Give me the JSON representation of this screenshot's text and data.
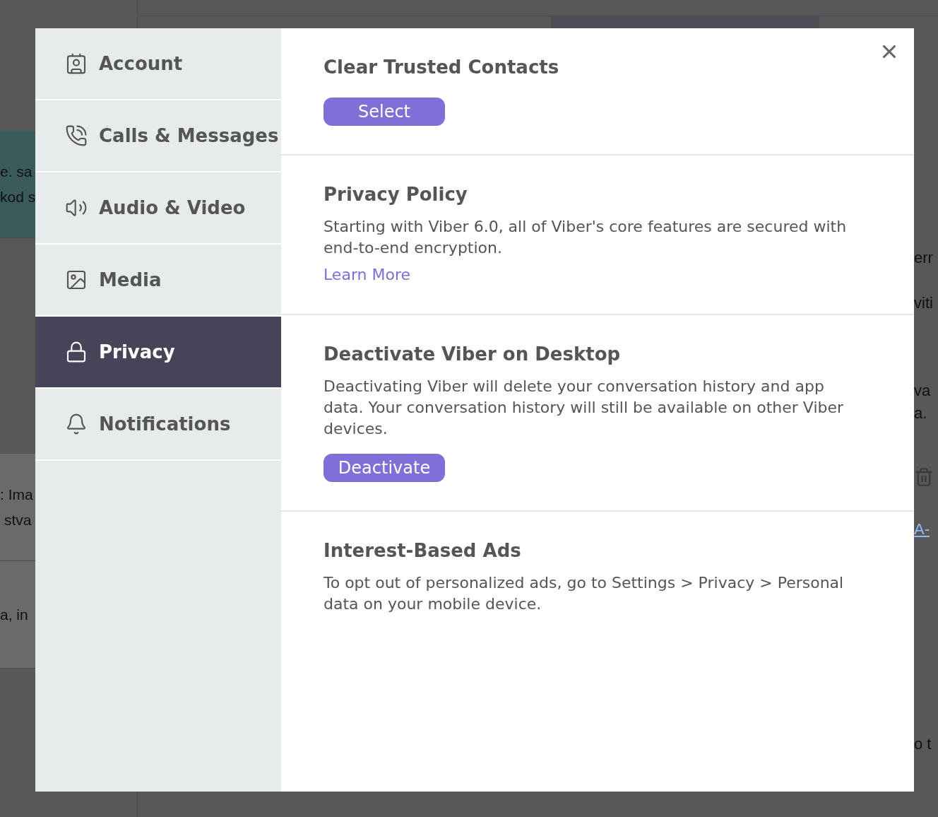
{
  "backdrop": {
    "chat_list": [
      {
        "lines": [
          "e. sa",
          "kod s"
        ],
        "selected": true
      },
      {
        "lines": [
          ": Ima",
          "stva"
        ],
        "selected": false
      },
      {
        "lines": [
          "a, in"
        ],
        "selected": false
      }
    ],
    "messages": [
      {
        "kind": "text",
        "lines": [
          "err"
        ]
      },
      {
        "kind": "text",
        "lines": [
          "viti"
        ]
      },
      {
        "kind": "text",
        "lines": [
          "va",
          "a."
        ]
      },
      {
        "kind": "delete"
      },
      {
        "kind": "link",
        "lines": [
          "A-"
        ]
      },
      {
        "kind": "text",
        "lines": [
          "o t"
        ]
      }
    ]
  },
  "settings": {
    "sidebar": {
      "items": [
        {
          "label": "Account",
          "selected": false
        },
        {
          "label": "Calls & Messages",
          "selected": false
        },
        {
          "label": "Audio & Video",
          "selected": false
        },
        {
          "label": "Media",
          "selected": false
        },
        {
          "label": "Privacy",
          "selected": true
        },
        {
          "label": "Notifications",
          "selected": false
        }
      ]
    },
    "sections": [
      {
        "title": "Clear Trusted Contacts",
        "button": "Select"
      },
      {
        "title": "Privacy Policy",
        "body": "Starting with Viber 6.0, all of Viber's core features are secured with end-to-end encryption.",
        "link": "Learn More"
      },
      {
        "title": "Deactivate Viber on Desktop",
        "body": "Deactivating Viber will delete your conversation history and app data. Your conversation history will still be available on other Viber devices.",
        "button": "Deactivate"
      },
      {
        "title": "Interest-Based Ads",
        "body": "To opt out of personalized ads, go to Settings > Privacy > Personal data on your mobile device."
      }
    ]
  }
}
